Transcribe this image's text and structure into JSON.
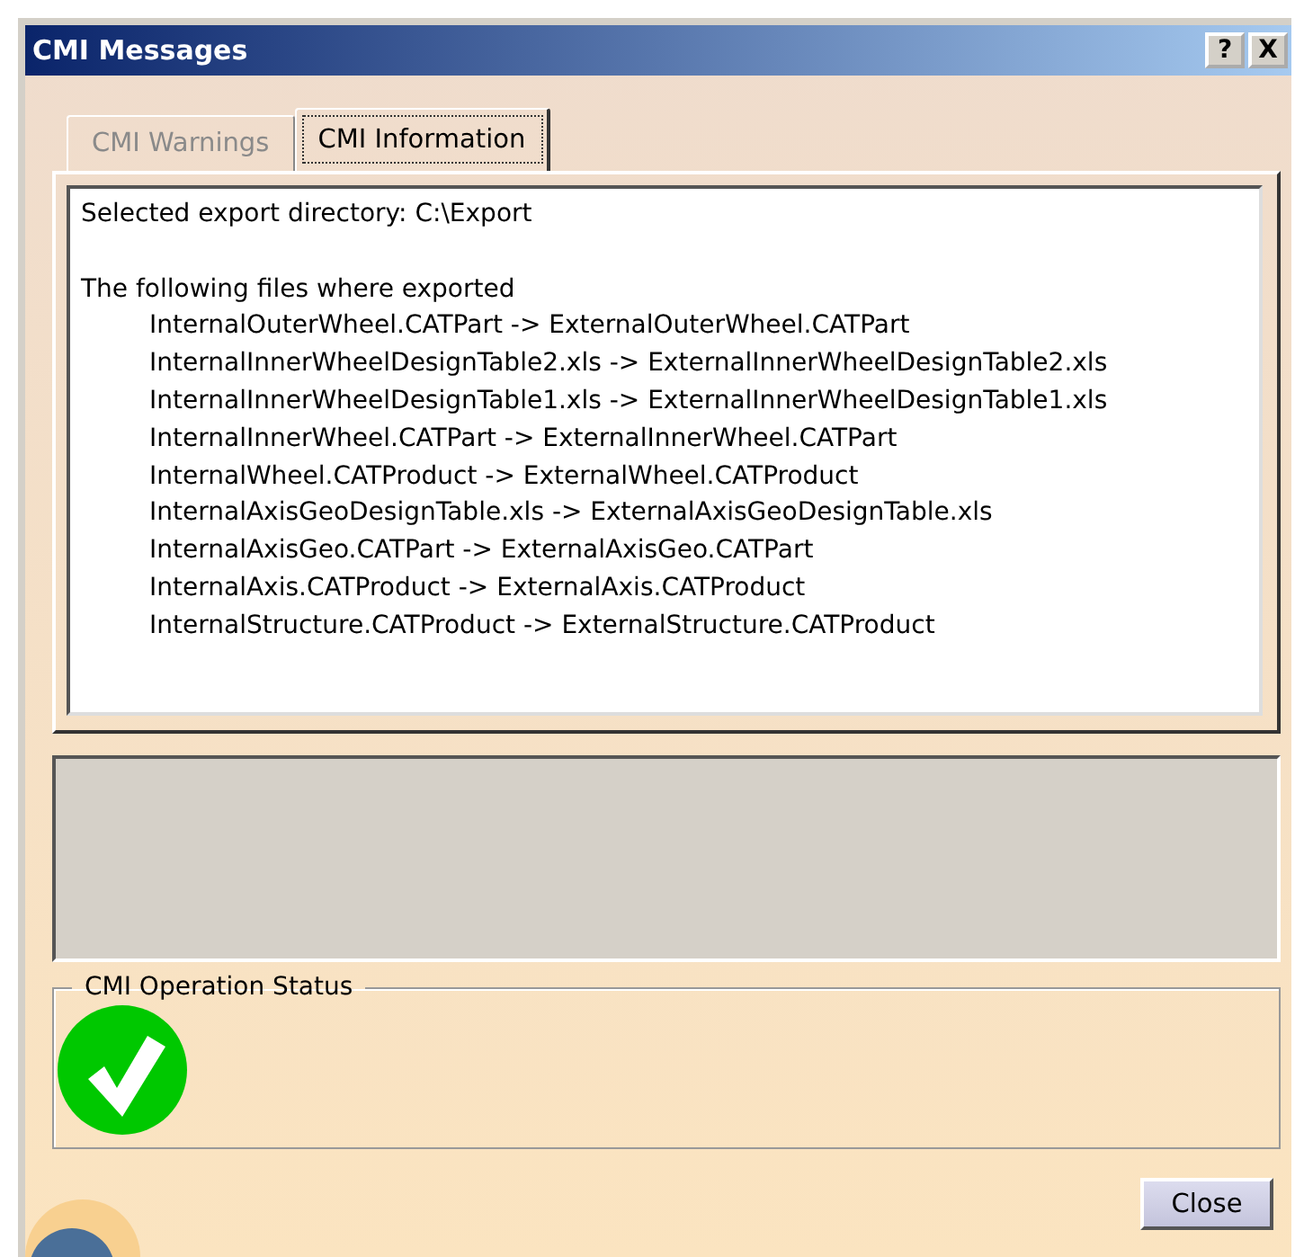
{
  "window": {
    "title": "CMI Messages",
    "title_buttons": [
      "?",
      "X"
    ]
  },
  "tabs": [
    {
      "label": "CMI Warnings",
      "selected": false
    },
    {
      "label": "CMI Information",
      "selected": true
    }
  ],
  "log": {
    "directory_line": "Selected export directory: C:\\Export",
    "heading": "The following files where exported",
    "files": [
      "InternalOuterWheel.CATPart -> ExternalOuterWheel.CATPart",
      "InternalInnerWheelDesignTable2.xls -> ExternalInnerWheelDesignTable2.xls",
      "InternalInnerWheelDesignTable1.xls -> ExternalInnerWheelDesignTable1.xls",
      "InternalInnerWheel.CATPart -> ExternalInnerWheel.CATPart",
      "InternalWheel.CATProduct -> ExternalWheel.CATProduct",
      "InternalAxisGeoDesignTable.xls -> ExternalAxisGeoDesignTable.xls",
      "InternalAxisGeo.CATPart -> ExternalAxisGeo.CATPart",
      "InternalAxis.CATProduct -> ExternalAxis.CATProduct",
      "InternalStructure.CATProduct -> ExternalStructure.CATProduct"
    ]
  },
  "status": {
    "label": "CMI Operation Status",
    "kind": "success"
  },
  "buttons": [
    "Close"
  ]
}
